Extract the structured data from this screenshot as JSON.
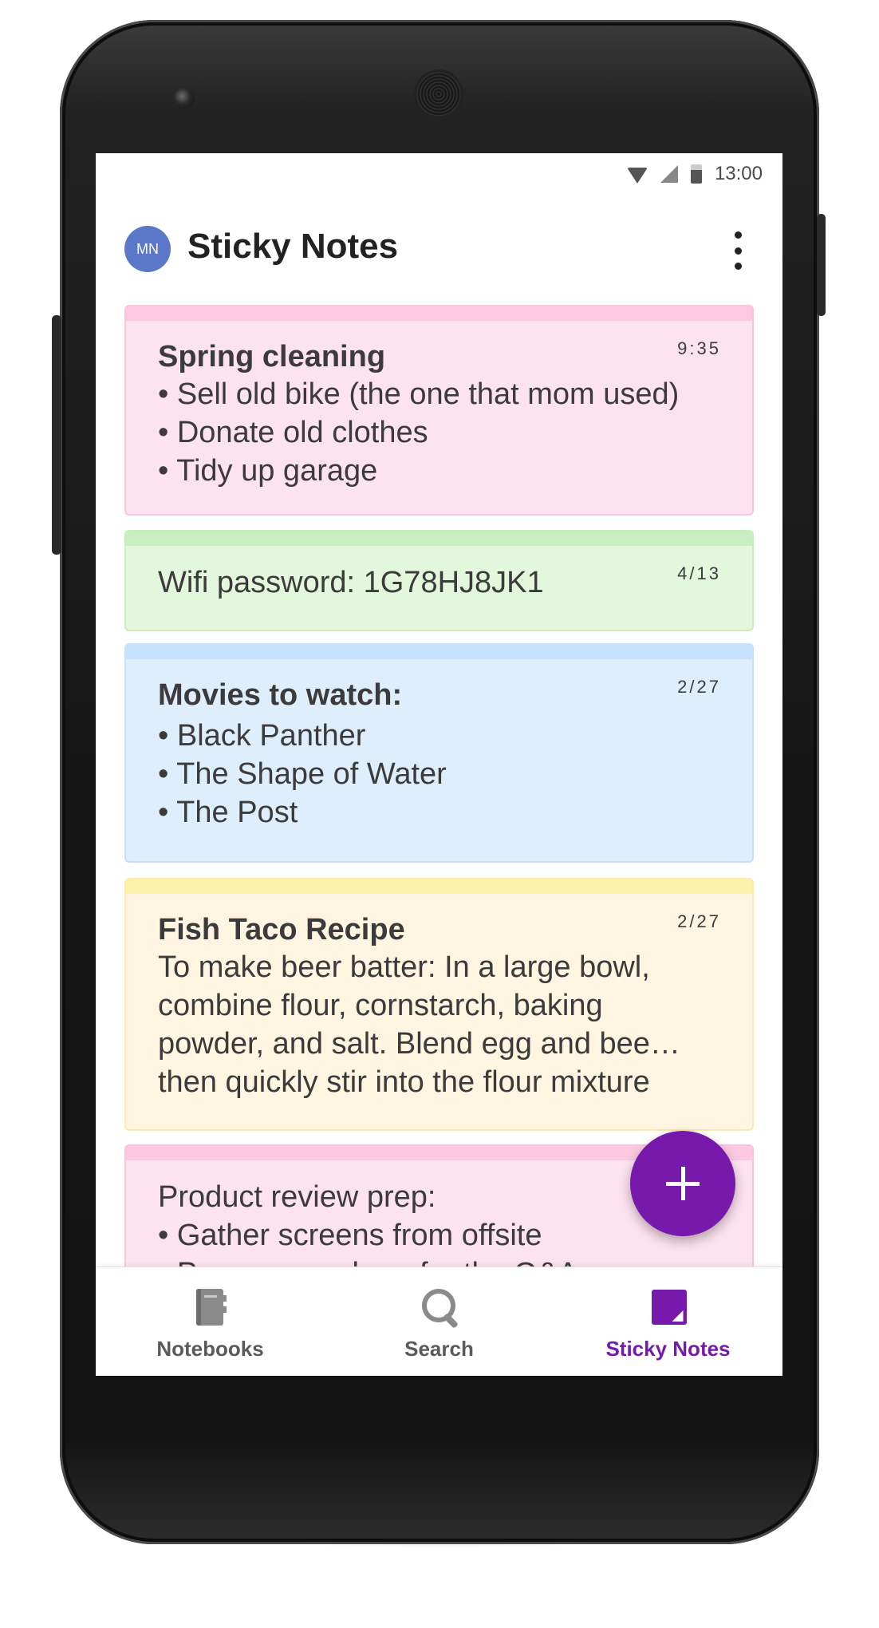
{
  "status_bar": {
    "time": "13:00",
    "icons": [
      "wifi-icon",
      "signal-icon",
      "battery-icon"
    ]
  },
  "header": {
    "avatar_initials": "MN",
    "title": "Sticky Notes",
    "menu_icon": "more-vertical-icon"
  },
  "notes": [
    {
      "color": "pink",
      "date": "9:35",
      "title": "Spring cleaning",
      "lines": [
        "• Sell old bike (the one that mom used)",
        "• Donate old clothes",
        "• Tidy up garage"
      ]
    },
    {
      "color": "green",
      "date": "4/13",
      "title": "",
      "lines": [
        "Wifi password: 1G78HJ8JK1"
      ]
    },
    {
      "color": "blue",
      "date": "2/27",
      "title": "Movies to watch:",
      "lines": [
        "• Black Panther",
        "• The Shape of Water",
        "• The Post"
      ]
    },
    {
      "color": "yellow",
      "date": "2/27",
      "title": "Fish Taco Recipe",
      "lines": [
        "To make beer batter: In a large bowl,",
        "combine flour, cornstarch, baking",
        "powder, and salt. Blend egg and bee…",
        "then quickly stir into the flour mixture"
      ]
    },
    {
      "color": "pink",
      "date": "",
      "title": "",
      "lines": [
        "Product review prep:",
        "• Gather screens from offsite",
        "• Prepare numbers for the Q&A"
      ]
    }
  ],
  "fab": {
    "icon": "plus-icon"
  },
  "bottom_nav": {
    "items": [
      {
        "label": "Notebooks",
        "icon": "notebooks-icon",
        "active": false
      },
      {
        "label": "Search",
        "icon": "search-icon",
        "active": false
      },
      {
        "label": "Sticky Notes",
        "icon": "sticky-notes-icon",
        "active": true
      }
    ]
  },
  "colors": {
    "accent": "#7719aa",
    "avatar": "#5a78c7",
    "pink_note": "#fde2ef",
    "green_note": "#e3f7dd",
    "blue_note": "#dfeefd",
    "yellow_note": "#fff5e0"
  }
}
